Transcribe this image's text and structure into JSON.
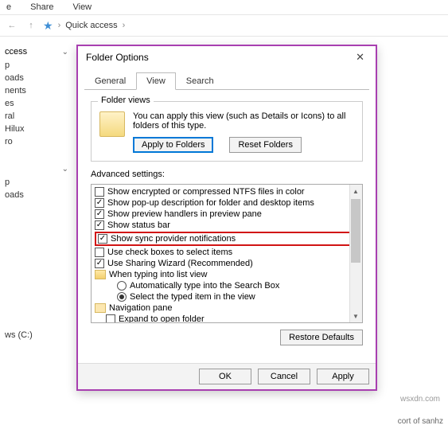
{
  "ribbon": {
    "tabs": [
      "e",
      "Share",
      "View"
    ]
  },
  "breadcrumb": {
    "root": "Quick access"
  },
  "sidebar": {
    "header": "ccess",
    "quick": [
      "p",
      "oads",
      "nents",
      "es",
      "ral",
      "Hilux",
      "ro"
    ],
    "second_header": "",
    "second": [
      "p",
      "oads"
    ],
    "drive": "ws (C:)"
  },
  "dialog": {
    "title": "Folder Options",
    "tabs": {
      "general": "General",
      "view": "View",
      "search": "Search"
    },
    "folder_views": {
      "legend": "Folder views",
      "desc": "You can apply this view (such as Details or Icons) to all folders of this type.",
      "apply": "Apply to Folders",
      "reset": "Reset Folders"
    },
    "advanced": {
      "label": "Advanced settings:",
      "items": [
        {
          "kind": "chk",
          "checked": false,
          "text": "Show encrypted or compressed NTFS files in color"
        },
        {
          "kind": "chk",
          "checked": true,
          "text": "Show pop-up description for folder and desktop items"
        },
        {
          "kind": "chk",
          "checked": true,
          "text": "Show preview handlers in preview pane"
        },
        {
          "kind": "chk",
          "checked": true,
          "text": "Show status bar"
        },
        {
          "kind": "chk",
          "checked": true,
          "text": "Show sync provider notifications",
          "hl": true
        },
        {
          "kind": "chk",
          "checked": false,
          "text": "Use check boxes to select items"
        },
        {
          "kind": "chk",
          "checked": true,
          "text": "Use Sharing Wizard (Recommended)"
        },
        {
          "kind": "folder",
          "text": "When typing into list view"
        },
        {
          "kind": "rad",
          "checked": false,
          "text": "Automatically type into the Search Box",
          "indent": 2
        },
        {
          "kind": "rad",
          "checked": true,
          "text": "Select the typed item in the view",
          "indent": 2
        },
        {
          "kind": "nav",
          "text": "Navigation pane"
        },
        {
          "kind": "chk",
          "checked": false,
          "text": "Expand to open folder",
          "indent": 1
        }
      ],
      "restore": "Restore Defaults"
    },
    "buttons": {
      "ok": "OK",
      "cancel": "Cancel",
      "apply": "Apply"
    }
  },
  "watermark": "wsxdn.com",
  "footer": "cort of sanhz"
}
